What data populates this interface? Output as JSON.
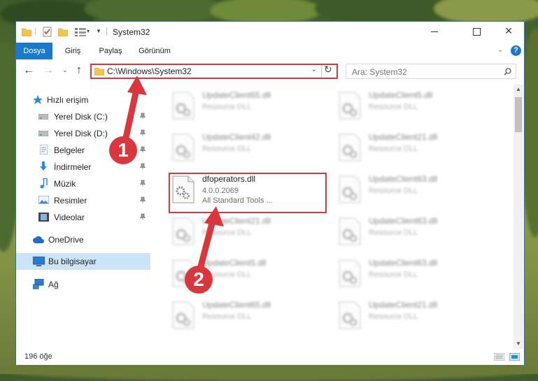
{
  "window": {
    "title": "System32",
    "help": "?"
  },
  "ribbon": {
    "tabs": [
      {
        "label": "Dosya"
      },
      {
        "label": "Giriş"
      },
      {
        "label": "Paylaş"
      },
      {
        "label": "Görünüm"
      }
    ]
  },
  "address": {
    "path": "C:\\Windows\\System32",
    "search_placeholder": "Ara: System32"
  },
  "sidebar": {
    "quick_access": "Hızlı erişim",
    "items": [
      {
        "label": "Yerel Disk (C:)"
      },
      {
        "label": "Yerel Disk (D:)"
      },
      {
        "label": "Belgeler"
      },
      {
        "label": "İndirmeler"
      },
      {
        "label": "Müzik"
      },
      {
        "label": "Resimler"
      },
      {
        "label": "Videolar"
      }
    ],
    "onedrive": "OneDrive",
    "this_pc": "Bu bilgisayar",
    "network": "Ağ"
  },
  "files": {
    "left": [
      {
        "name": "UpdateClient65.dll",
        "type": "Resource DLL"
      },
      {
        "name": "UpdateClient42.dll",
        "type": "Resource DLL"
      },
      {
        "name": "dfoperators.dll",
        "version": "4.0.0.2069",
        "company": "All Standard Tools ..."
      },
      {
        "name": "UpdateClient21.dll",
        "type": "Resource DLL"
      },
      {
        "name": "UpdateClient5.dll",
        "type": "Resource DLL"
      },
      {
        "name": "UpdateClient65.dll",
        "type": "Resource DLL"
      }
    ],
    "right": [
      {
        "name": "UpdateClient5.dll",
        "type": "Resource DLL"
      },
      {
        "name": "UpdateClient21.dll",
        "type": "Resource DLL"
      },
      {
        "name": "UpdateClient63.dll",
        "type": "Resource DLL"
      },
      {
        "name": "UpdateClient63.dll",
        "type": "Resource DLL"
      },
      {
        "name": "UpdateClient63.dll",
        "type": "Resource DLL"
      },
      {
        "name": "UpdateClient21.dll",
        "type": "Resource DLL"
      }
    ]
  },
  "status": {
    "count": "196 öğe"
  },
  "annotations": {
    "step1": "1",
    "step2": "2",
    "color": "#d9363e"
  }
}
